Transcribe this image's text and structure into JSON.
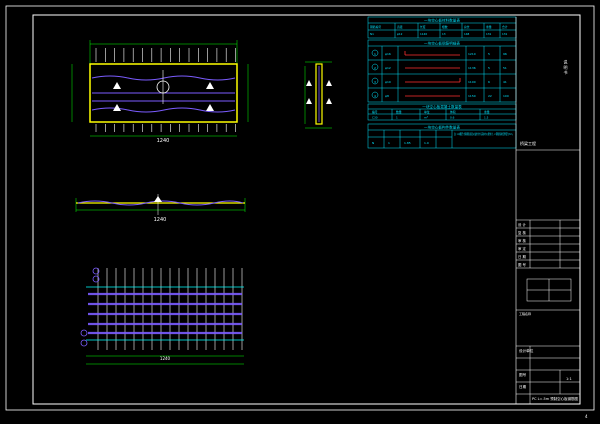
{
  "drawing": {
    "title_label": "桥梁工程",
    "title_block_title": "PC L=.5m 预制空心板钢筋图",
    "side_note": "说 明 书",
    "scale_label": "1:1",
    "sheet_no": "1",
    "corner_number": "4"
  },
  "table_top": {
    "title": "一块空心板材料数量表",
    "headers": [
      "钢筋编号",
      "直径",
      "长度",
      "根数",
      "总长",
      "重量",
      "合计"
    ],
    "rows": [
      [
        "N1",
        "φ12",
        "1140",
        "13",
        "148",
        "131",
        "131"
      ]
    ]
  },
  "table_mid": {
    "title": "一块空心板钢筋明细表",
    "rows": [
      {
        "no": "1",
        "dia": "φ16",
        "len": "1210",
        "cnt": "5",
        "wt": "96"
      },
      {
        "no": "2",
        "dia": "φ12",
        "len": "1136",
        "cnt": "5",
        "wt": "51"
      },
      {
        "no": "3",
        "dia": "φ10",
        "len": "1100",
        "cnt": "6",
        "wt": "41"
      },
      {
        "no": "4",
        "dia": "φ8",
        "len": "1150",
        "cnt": "22",
        "wt": "100"
      }
    ]
  },
  "table_low": {
    "title": "一块空心板混凝土数量表",
    "headers": [
      "编号",
      "数量",
      "单位",
      "体积",
      "重量"
    ],
    "rows": [
      [
        "C30",
        "1",
        "m³",
        "0.6",
        "1.5"
      ]
    ]
  },
  "table_foot": {
    "title": "一块空心板构件数量表",
    "note": "注: 1.本图尺寸除钢筋直径以毫米计外,其余均以厘米计。2.钢筋保护层厚度为3cm。",
    "row": [
      "N",
      "1",
      "1.85",
      "1.0"
    ]
  },
  "title_block": {
    "rows": [
      "设 计",
      "复 核",
      "审 核",
      "审 定",
      "日 期",
      "图 号"
    ],
    "design_unit": "设计单位",
    "project": "工程名称",
    "drawing_no_label": "图号",
    "date_label": "日期"
  },
  "dimensions": {
    "plan_total": "1240",
    "elev_total": "1240",
    "rebar_total": "1240"
  },
  "colors": {
    "frame": "#ffffff",
    "table": "#00e5ff",
    "dim": "#00ff00",
    "slab": "#ffff00",
    "rebar": "#7b5cff",
    "marker": "#ff3030"
  }
}
